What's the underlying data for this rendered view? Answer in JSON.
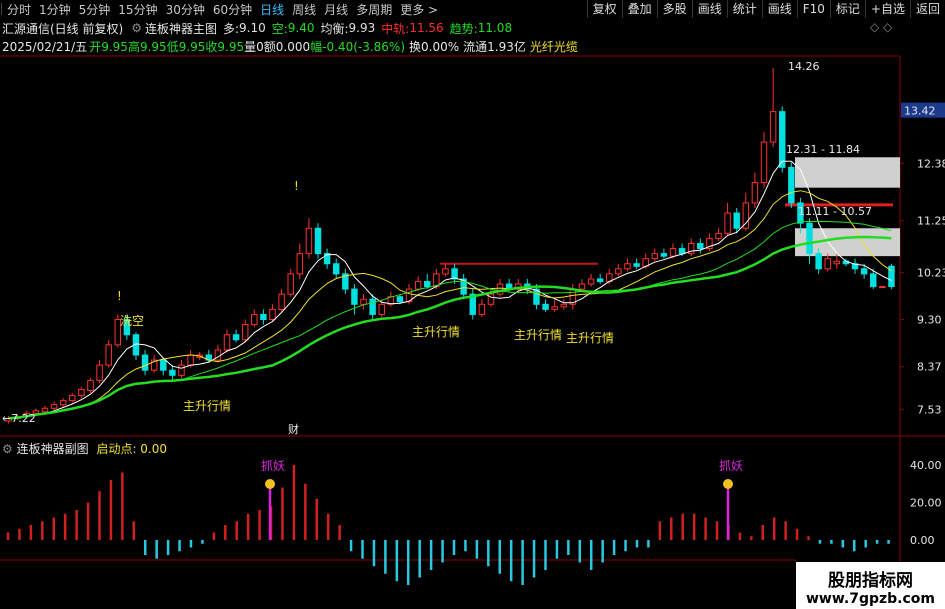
{
  "topbar": {
    "tabs": [
      "分时",
      "1分钟",
      "5分钟",
      "15分钟",
      "30分钟",
      "60分钟",
      "日线",
      "周线",
      "月线",
      "多周期",
      "更多 >"
    ],
    "active_tab": "日线",
    "tools": [
      "复权",
      "叠加",
      "多股",
      "画线",
      "统计",
      "画线",
      "F10",
      "标记",
      "+自选",
      "返回"
    ]
  },
  "title": {
    "stock": "汇源通信(日线 前复权)",
    "indicator": "连板神器主图",
    "duo_label": "多:",
    "duo_value": "9.10",
    "kong_label": "空:",
    "kong_value": "9.40",
    "jh_label": "均衡:",
    "jh_value": "9.93",
    "zg_label": "中轨:",
    "zg_value": "11.56",
    "qs_label": "趋势:",
    "qs_value": "11.08"
  },
  "info": {
    "date": "2025/02/21/五",
    "open": "开9.95",
    "high": "高9.95",
    "low": "低9.95",
    "close": "收9.95",
    "vol": "量0",
    "amt": "额0.000",
    "amp": "幅-0.40(-3.86%)",
    "turnover": "换0.00%",
    "float": "流通1.93亿",
    "concept": "光纤光缆"
  },
  "yaxis": [
    "13.42",
    "12.38",
    "11.25",
    "10.23",
    "9.30",
    "8.37",
    "7.53"
  ],
  "annotations": {
    "high_mark": "14.26",
    "low_mark": "←7.22",
    "range1": "12.31 - 11.84",
    "range2": "11.11 - 10.57",
    "zs1": "主升行情",
    "zs2": "主升行情",
    "zs3": "主升行情",
    "zs4": "主升行情",
    "xk": "洗空",
    "cai": "财",
    "excl": "!"
  },
  "sub": {
    "title": "连板神器副图",
    "param": "启动点: 0.00",
    "y": [
      "40.00",
      "20.00",
      "0.00"
    ],
    "label": "抓妖"
  },
  "watermark": {
    "line1": "股朋指标网",
    "line2": "www.7gpzb.com"
  },
  "colors": {
    "up": "#ff3030",
    "down": "#00e0e0",
    "ma_green": "#22dd22",
    "sub_up": "#d02020",
    "sub_down": "#28c8e0",
    "mark": "#dd22dd",
    "yellow": "#f0e030"
  },
  "chart_data": {
    "type": "candlestick",
    "price_ylim": [
      7.2,
      14.3
    ],
    "candles": [
      [
        7.3,
        7.35,
        7.25,
        7.4
      ],
      [
        7.35,
        7.38,
        7.32,
        7.42
      ],
      [
        7.4,
        7.45,
        7.38,
        7.5
      ],
      [
        7.45,
        7.5,
        7.4,
        7.55
      ],
      [
        7.48,
        7.55,
        7.45,
        7.6
      ],
      [
        7.55,
        7.62,
        7.5,
        7.68
      ],
      [
        7.62,
        7.7,
        7.58,
        7.75
      ],
      [
        7.7,
        7.8,
        7.66,
        7.85
      ],
      [
        7.8,
        7.92,
        7.75,
        7.98
      ],
      [
        7.9,
        8.1,
        7.85,
        8.15
      ],
      [
        8.1,
        8.4,
        8.05,
        8.5
      ],
      [
        8.4,
        8.8,
        8.35,
        8.9
      ],
      [
        8.8,
        9.3,
        8.75,
        9.4
      ],
      [
        9.3,
        9.0,
        8.9,
        9.4
      ],
      [
        9.0,
        8.6,
        8.5,
        9.05
      ],
      [
        8.6,
        8.3,
        8.2,
        8.7
      ],
      [
        8.3,
        8.5,
        8.25,
        8.6
      ],
      [
        8.5,
        8.3,
        8.2,
        8.55
      ],
      [
        8.3,
        8.2,
        8.1,
        8.4
      ],
      [
        8.2,
        8.4,
        8.15,
        8.5
      ],
      [
        8.4,
        8.6,
        8.35,
        8.7
      ],
      [
        8.55,
        8.6,
        8.5,
        8.66
      ],
      [
        8.6,
        8.5,
        8.45,
        8.7
      ],
      [
        8.5,
        8.7,
        8.45,
        8.8
      ],
      [
        8.7,
        9.0,
        8.65,
        9.1
      ],
      [
        9.0,
        8.9,
        8.85,
        9.1
      ],
      [
        8.9,
        9.2,
        8.85,
        9.3
      ],
      [
        9.2,
        9.4,
        9.15,
        9.5
      ],
      [
        9.4,
        9.3,
        9.2,
        9.5
      ],
      [
        9.3,
        9.5,
        9.25,
        9.6
      ],
      [
        9.5,
        9.8,
        9.45,
        9.9
      ],
      [
        9.8,
        10.2,
        9.75,
        10.3
      ],
      [
        10.2,
        10.6,
        10.1,
        10.8
      ],
      [
        10.6,
        11.1,
        10.5,
        11.3
      ],
      [
        11.1,
        10.6,
        10.5,
        11.2
      ],
      [
        10.6,
        10.4,
        10.3,
        10.7
      ],
      [
        10.4,
        10.2,
        10.1,
        10.5
      ],
      [
        10.2,
        9.9,
        9.8,
        10.3
      ],
      [
        9.9,
        9.6,
        9.4,
        10.0
      ],
      [
        9.6,
        9.7,
        9.5,
        9.8
      ],
      [
        9.7,
        9.4,
        9.3,
        9.8
      ],
      [
        9.4,
        9.6,
        9.35,
        9.7
      ],
      [
        9.6,
        9.75,
        9.55,
        9.85
      ],
      [
        9.75,
        9.65,
        9.6,
        9.8
      ],
      [
        9.65,
        9.9,
        9.6,
        10.0
      ],
      [
        9.9,
        10.05,
        9.85,
        10.15
      ],
      [
        10.05,
        9.95,
        9.9,
        10.2
      ],
      [
        9.95,
        10.2,
        9.9,
        10.3
      ],
      [
        10.2,
        10.3,
        10.15,
        10.4
      ],
      [
        10.3,
        10.1,
        10.0,
        10.4
      ],
      [
        10.1,
        9.8,
        9.7,
        10.2
      ],
      [
        9.8,
        9.4,
        9.3,
        9.9
      ],
      [
        9.4,
        9.6,
        9.35,
        9.7
      ],
      [
        9.6,
        9.8,
        9.55,
        9.9
      ],
      [
        9.8,
        10.0,
        9.75,
        10.1
      ],
      [
        10.0,
        9.9,
        9.85,
        10.1
      ],
      [
        9.9,
        10.0,
        9.85,
        10.1
      ],
      [
        10.0,
        9.9,
        9.8,
        10.1
      ],
      [
        9.9,
        9.6,
        9.5,
        10.0
      ],
      [
        9.6,
        9.5,
        9.45,
        9.7
      ],
      [
        9.5,
        9.55,
        9.45,
        9.7
      ],
      [
        9.55,
        9.6,
        9.5,
        9.7
      ],
      [
        9.6,
        9.9,
        9.5,
        10.0
      ],
      [
        9.9,
        10.0,
        9.85,
        10.1
      ],
      [
        10.0,
        10.1,
        9.95,
        10.2
      ],
      [
        10.1,
        10.05,
        10.0,
        10.2
      ],
      [
        10.05,
        10.2,
        10.0,
        10.3
      ],
      [
        10.2,
        10.3,
        10.15,
        10.4
      ],
      [
        10.3,
        10.4,
        10.25,
        10.5
      ],
      [
        10.4,
        10.35,
        10.3,
        10.5
      ],
      [
        10.35,
        10.5,
        10.3,
        10.6
      ],
      [
        10.5,
        10.6,
        10.45,
        10.7
      ],
      [
        10.6,
        10.55,
        10.5,
        10.7
      ],
      [
        10.55,
        10.7,
        10.5,
        10.8
      ],
      [
        10.7,
        10.6,
        10.55,
        10.8
      ],
      [
        10.6,
        10.8,
        10.55,
        10.9
      ],
      [
        10.8,
        10.7,
        10.6,
        10.9
      ],
      [
        10.7,
        10.9,
        10.65,
        11.0
      ],
      [
        10.9,
        11.0,
        10.85,
        11.1
      ],
      [
        11.0,
        11.4,
        10.95,
        11.6
      ],
      [
        11.4,
        11.1,
        11.0,
        11.5
      ],
      [
        11.1,
        11.6,
        11.05,
        11.8
      ],
      [
        11.6,
        12.0,
        11.5,
        12.2
      ],
      [
        12.0,
        12.8,
        11.9,
        13.0
      ],
      [
        12.8,
        13.4,
        12.7,
        14.26
      ],
      [
        13.4,
        12.3,
        12.2,
        13.5
      ],
      [
        12.3,
        11.6,
        11.5,
        12.4
      ],
      [
        11.6,
        11.2,
        11.0,
        11.7
      ],
      [
        11.2,
        10.6,
        10.4,
        11.3
      ],
      [
        10.6,
        10.3,
        10.2,
        10.7
      ],
      [
        10.3,
        10.5,
        10.25,
        10.6
      ],
      [
        10.4,
        10.45,
        10.3,
        10.6
      ],
      [
        10.45,
        10.4,
        10.35,
        10.5
      ],
      [
        10.4,
        10.3,
        10.2,
        10.5
      ],
      [
        10.3,
        10.2,
        10.1,
        10.4
      ],
      [
        10.2,
        9.95,
        9.9,
        10.3
      ],
      [
        9.95,
        9.95,
        9.95,
        9.95
      ],
      [
        10.35,
        9.95,
        9.9,
        10.4
      ]
    ],
    "sub_values": [
      4,
      6,
      8,
      10,
      12,
      14,
      16,
      20,
      26,
      32,
      36,
      10,
      -8,
      -10,
      -8,
      -6,
      -4,
      -2,
      4,
      8,
      10,
      14,
      16,
      18,
      28,
      40,
      30,
      22,
      14,
      8,
      -6,
      -10,
      -14,
      -18,
      -22,
      -24,
      -20,
      -16,
      -12,
      -8,
      -6,
      -10,
      -14,
      -18,
      -22,
      -24,
      -20,
      -16,
      -10,
      -8,
      -12,
      -16,
      -12,
      -8,
      -6,
      -4,
      -4,
      10,
      12,
      14,
      14,
      12,
      10,
      8,
      4,
      2,
      8,
      12,
      10,
      6,
      2,
      -2,
      -2,
      -4,
      -6,
      -4,
      -2,
      -2
    ],
    "markers": [
      "主升行情",
      "主升行情",
      "主升行情",
      "主升行情",
      "洗空"
    ]
  }
}
